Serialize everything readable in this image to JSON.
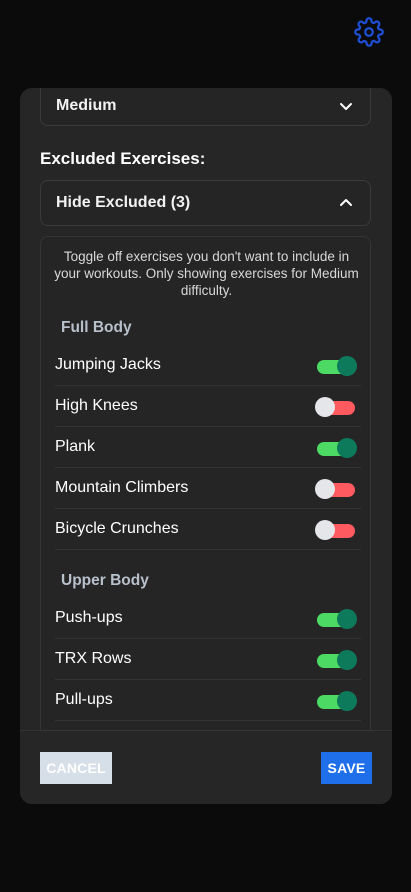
{
  "header": {
    "settings_icon": "gear-icon",
    "icon_color": "#1e4fd6"
  },
  "modal": {
    "difficulty": {
      "value": "Medium",
      "icon": "chevron-down-icon"
    },
    "excluded_title": "Excluded Exercises:",
    "hide_toggle": {
      "label": "Hide Excluded (3)",
      "icon": "chevron-up-icon"
    },
    "description": "Toggle off exercises you don't want to include in your workouts. Only showing exercises for Medium difficulty.",
    "categories": [
      {
        "name": "Full Body",
        "exercises": [
          {
            "name": "Jumping Jacks",
            "enabled": true
          },
          {
            "name": "High Knees",
            "enabled": false
          },
          {
            "name": "Plank",
            "enabled": true
          },
          {
            "name": "Mountain Climbers",
            "enabled": false
          },
          {
            "name": "Bicycle Crunches",
            "enabled": false
          }
        ]
      },
      {
        "name": "Upper Body",
        "exercises": [
          {
            "name": "Push-ups",
            "enabled": true
          },
          {
            "name": "TRX Rows",
            "enabled": true
          },
          {
            "name": "Pull-ups",
            "enabled": true
          }
        ]
      }
    ]
  },
  "footer": {
    "cancel_label": "CANCEL",
    "save_label": "SAVE"
  },
  "colors": {
    "toggle_on": "#4cd964",
    "toggle_off": "#ff5a5f",
    "primary": "#1f6feb"
  }
}
